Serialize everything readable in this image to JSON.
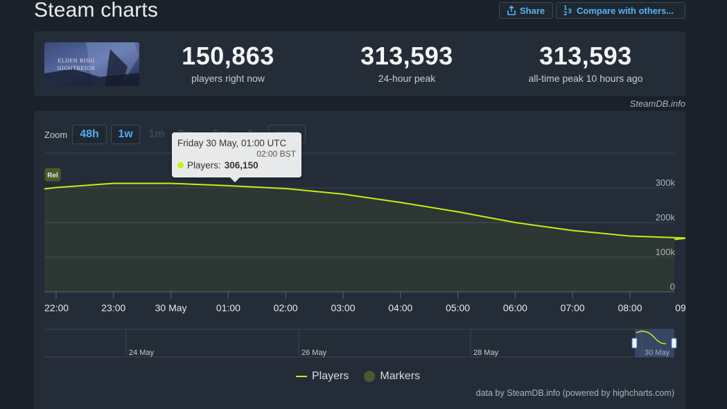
{
  "page": {
    "title": "Steam charts"
  },
  "toolbar": {
    "share_label": "Share",
    "compare_label": "Compare with others..."
  },
  "game": {
    "logo_text": "ELDEN RING NIGHTREIGN"
  },
  "stats": [
    {
      "value": "150,863",
      "label": "players right now"
    },
    {
      "value": "313,593",
      "label": "24-hour peak"
    },
    {
      "value": "313,593",
      "label": "all-time peak 10 hours ago"
    }
  ],
  "credit_top": "SteamDB.info",
  "zoom": {
    "label": "Zoom",
    "options": [
      {
        "label": "48h",
        "enabled": true
      },
      {
        "label": "1w",
        "enabled": true
      },
      {
        "label": "1m",
        "enabled": false
      },
      {
        "label": "3m",
        "enabled": false
      },
      {
        "label": "6m",
        "enabled": false
      },
      {
        "label": "1y",
        "enabled": false
      },
      {
        "label": "max",
        "enabled": false
      }
    ]
  },
  "tooltip": {
    "date": "Friday 30 May, 01:00 UTC",
    "alt_time": "02:00 BST",
    "series_label": "Players:",
    "value": "306,150"
  },
  "chart_data": {
    "type": "area",
    "series": [
      {
        "name": "Players",
        "color": "#c5f014",
        "x": [
          "21:50",
          "22:00",
          "23:00",
          "30 May",
          "01:00",
          "02:00",
          "03:00",
          "04:00",
          "05:00",
          "06:00",
          "07:00",
          "08:00",
          "09:00",
          "09:10"
        ],
        "values": [
          297000,
          301000,
          313000,
          313000,
          306150,
          298000,
          282000,
          258000,
          231000,
          200000,
          177000,
          161000,
          155000,
          151000
        ]
      }
    ],
    "x_ticks": [
      "22:00",
      "23:00",
      "30 May",
      "01:00",
      "02:00",
      "03:00",
      "04:00",
      "05:00",
      "06:00",
      "07:00",
      "08:00",
      "09:00"
    ],
    "y_ticks": [
      "0",
      "100k",
      "200k",
      "300k"
    ],
    "ylim": [
      0,
      400000
    ],
    "marker": {
      "label": "Rel"
    },
    "navigator_ticks": [
      "24 May",
      "26 May",
      "28 May",
      "30 May"
    ],
    "grid": true,
    "legend": [
      "Players",
      "Markers"
    ]
  },
  "colors": {
    "line": "#c5f014",
    "marker": "#4a5a2e",
    "accent": "#55b4f2"
  },
  "credit_bottom": "data by SteamDB.info (powered by highcharts.com)"
}
